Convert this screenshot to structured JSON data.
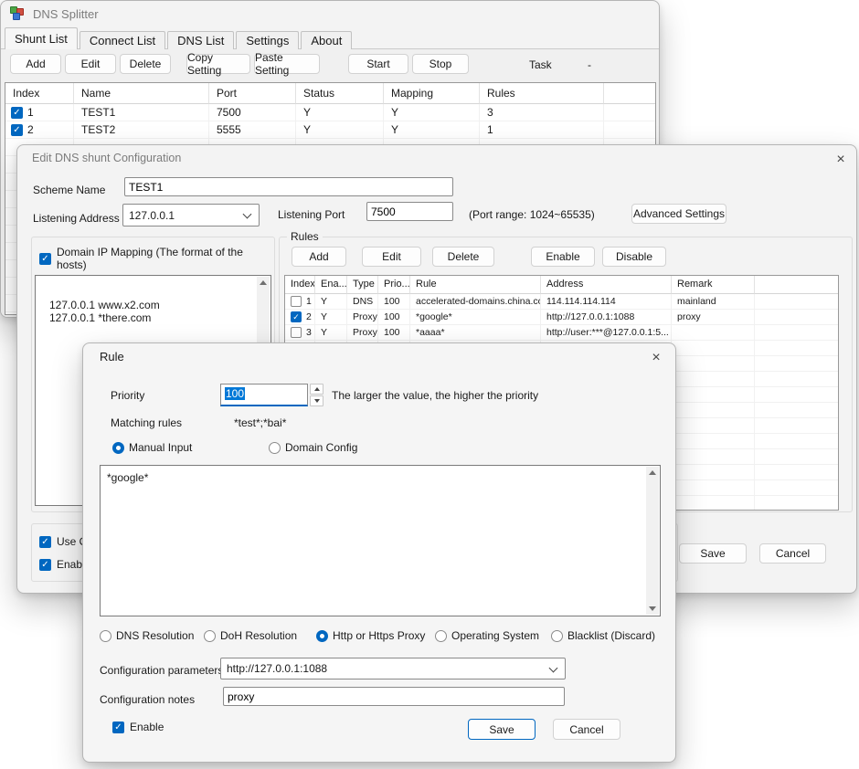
{
  "colors": {
    "accent": "#0067c0",
    "selection": "#0078d7"
  },
  "main_window": {
    "title": "DNS Splitter",
    "tabs": [
      "Shunt List",
      "Connect List",
      "DNS List",
      "Settings",
      "About"
    ],
    "active_tab": "Shunt List",
    "toolbar": {
      "buttons": [
        "Add",
        "Edit",
        "Delete",
        "Copy Setting",
        "Paste Setting",
        "Start",
        "Stop"
      ],
      "task_label": "Task",
      "task_value": "-"
    },
    "table": {
      "headers": [
        "Index",
        "Name",
        "Port",
        "Status",
        "Mapping",
        "Rules"
      ],
      "rows": [
        {
          "checked": true,
          "index": "1",
          "name": "TEST1",
          "port": "7500",
          "status": "Y",
          "mapping": "Y",
          "rules": "3"
        },
        {
          "checked": true,
          "index": "2",
          "name": "TEST2",
          "port": "5555",
          "status": "Y",
          "mapping": "Y",
          "rules": "1"
        }
      ]
    }
  },
  "edit_dialog": {
    "title": "Edit DNS shunt Configuration",
    "scheme_name_label": "Scheme Name",
    "scheme_name_value": "TEST1",
    "listening_address_label": "Listening Address",
    "listening_address_value": "127.0.0.1",
    "listening_port_label": "Listening Port",
    "listening_port_value": "7500",
    "port_range_hint": "(Port range: 1024~65535)",
    "advanced_settings_label": "Advanced Settings",
    "mapping_checkbox_label": "Domain IP Mapping (The format of the hosts)",
    "mapping_text": "127.0.0.1 www.x2.com\n127.0.0.1 *there.com",
    "rules_label": "Rules",
    "rules_buttons": [
      "Add",
      "Edit",
      "Delete",
      "Enable",
      "Disable"
    ],
    "rules_table": {
      "headers": [
        "Index",
        "Ena...",
        "Type",
        "Prio...",
        "Rule",
        "Address",
        "Remark"
      ],
      "rows": [
        {
          "checked": false,
          "index": "1",
          "enabled": "Y",
          "type": "DNS",
          "priority": "100",
          "rule": "accelerated-domains.china.conf",
          "address": "114.114.114.114",
          "remark": "mainland"
        },
        {
          "checked": true,
          "index": "2",
          "enabled": "Y",
          "type": "Proxy",
          "priority": "100",
          "rule": "*google*",
          "address": "http://127.0.0.1:1088",
          "remark": "proxy"
        },
        {
          "checked": false,
          "index": "3",
          "enabled": "Y",
          "type": "Proxy",
          "priority": "100",
          "rule": "*aaaa*",
          "address": "http://user:***@127.0.0.1:5...",
          "remark": ""
        }
      ]
    },
    "use_os_label": "Use OS",
    "enable_label": "Enable (",
    "save_label": "Save",
    "cancel_label": "Cancel"
  },
  "rule_dialog": {
    "title": "Rule",
    "priority_label": "Priority",
    "priority_value": "100",
    "priority_hint": "The larger the value, the higher the priority",
    "matching_label": "Matching rules",
    "matching_value": "*test*;*bai*",
    "radio_manual": "Manual Input",
    "radio_domain": "Domain Config",
    "rule_text": "*google*",
    "type_radios": [
      "DNS Resolution",
      "DoH Resolution",
      "Http or Https Proxy",
      "Operating System",
      "Blacklist (Discard)"
    ],
    "type_selected": "Http or Https Proxy",
    "config_params_label": "Configuration parameters",
    "config_params_value": "http://127.0.0.1:1088",
    "config_notes_label": "Configuration notes",
    "config_notes_value": "proxy",
    "enable_label": "Enable",
    "save_label": "Save",
    "cancel_label": "Cancel"
  }
}
